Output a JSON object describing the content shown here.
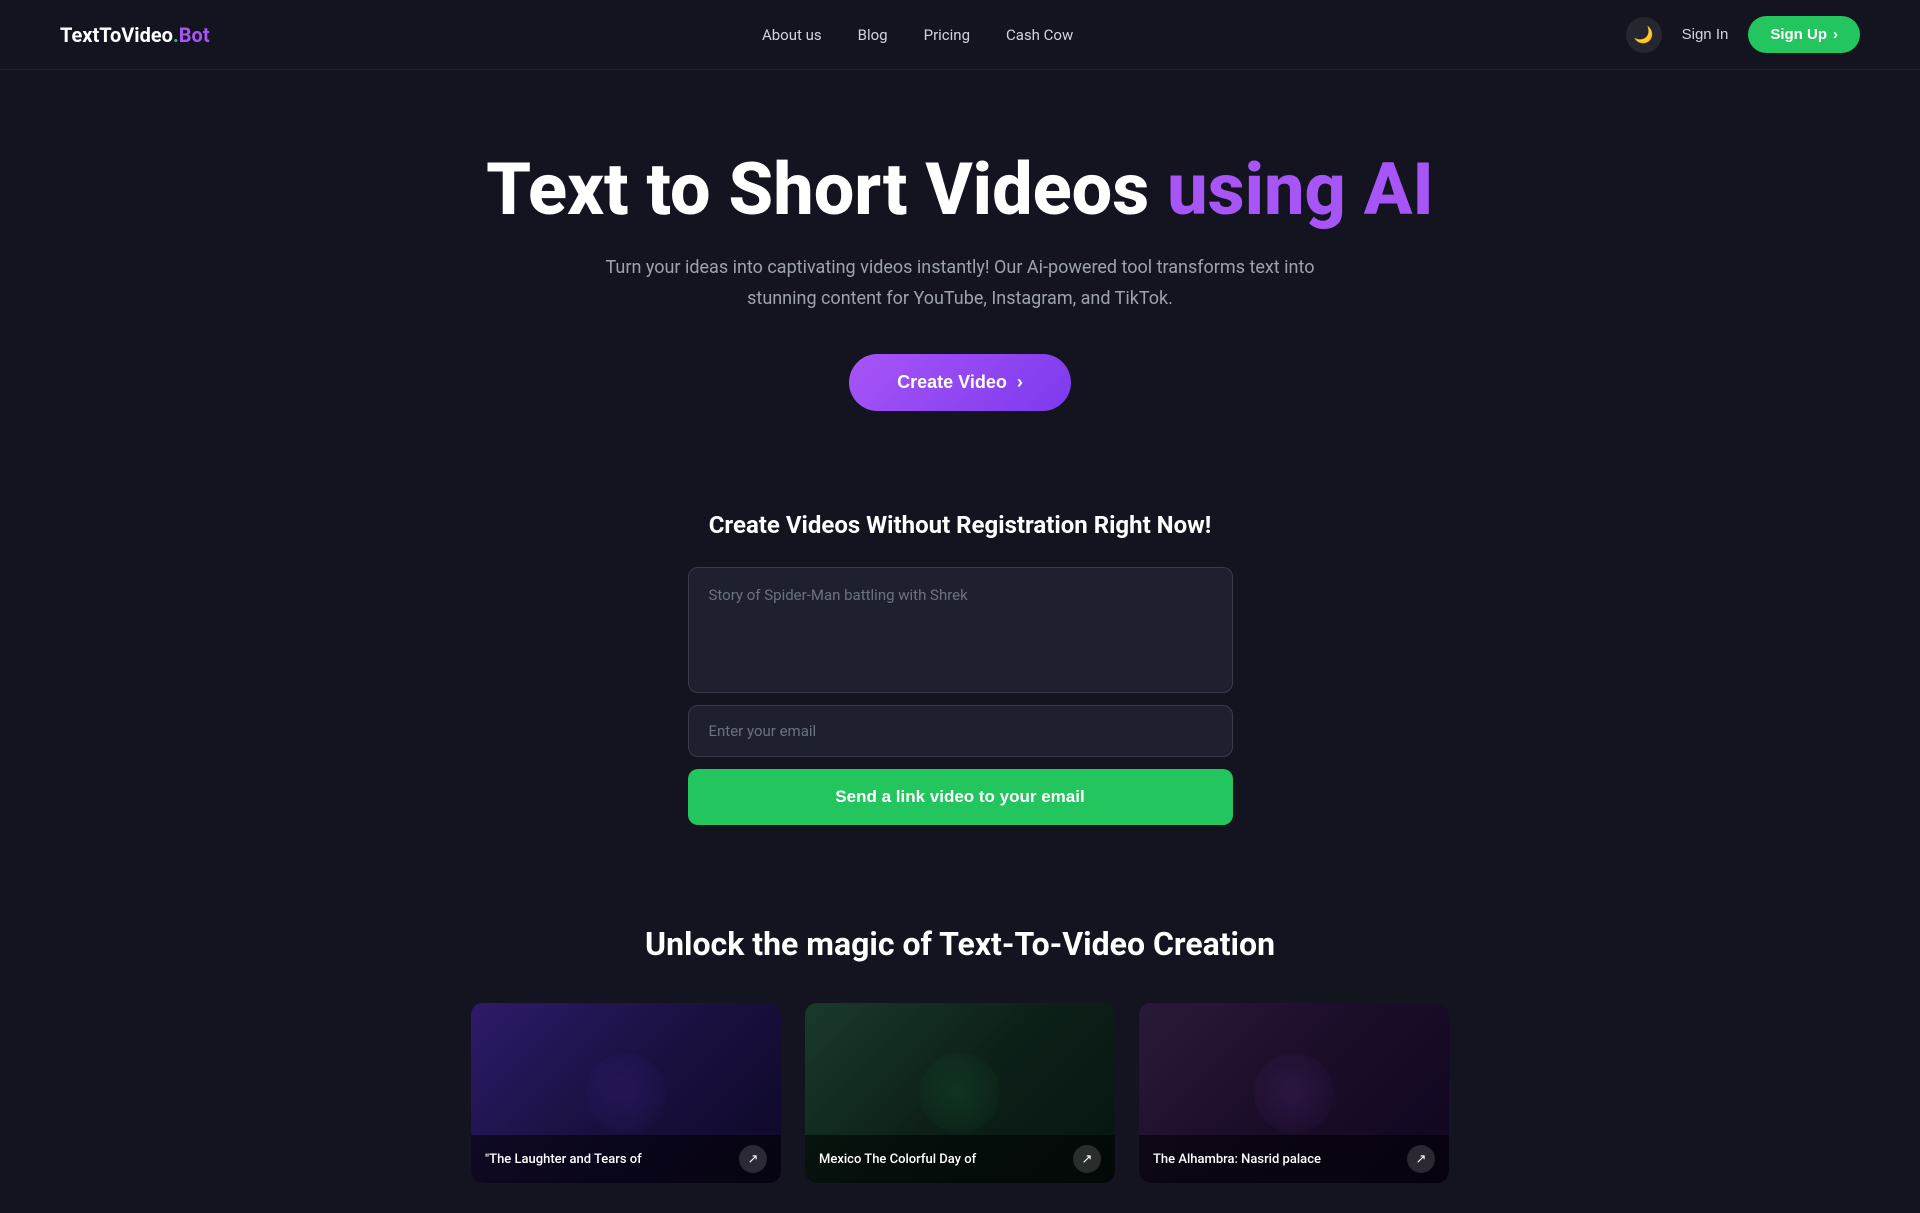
{
  "logo": {
    "text": "TextToVideo",
    "dot": ".",
    "bot": "Bot"
  },
  "nav": {
    "links": [
      {
        "label": "About us",
        "id": "about-us"
      },
      {
        "label": "Blog",
        "id": "blog"
      },
      {
        "label": "Pricing",
        "id": "pricing"
      },
      {
        "label": "Cash Cow",
        "id": "cash-cow"
      }
    ],
    "sign_in_label": "Sign In",
    "sign_up_label": "Sign Up"
  },
  "hero": {
    "title_part1": "Text to Short Videos ",
    "title_highlight": "using AI",
    "subtitle": "Turn your ideas into captivating videos instantly! Our Ai-powered tool transforms text into stunning content for YouTube, Instagram, and TikTok.",
    "create_btn_label": "Create Video"
  },
  "form_section": {
    "heading": "Create Videos Without Registration Right Now!",
    "textarea_placeholder": "Story of Spider-Man battling with Shrek",
    "email_placeholder": "Enter your email",
    "submit_btn_label": "Send a link video to your email"
  },
  "unlock_section": {
    "heading": "Unlock the magic of Text-To-Video Creation",
    "video_cards": [
      {
        "title": "\"The Laughter and Tears of",
        "id": "card-1"
      },
      {
        "title": "Mexico The Colorful Day of",
        "id": "card-2"
      },
      {
        "title": "The Alhambra: Nasrid palace",
        "id": "card-3"
      }
    ]
  },
  "icons": {
    "arrow_right": "›",
    "moon": "🌙",
    "share": "↗"
  }
}
